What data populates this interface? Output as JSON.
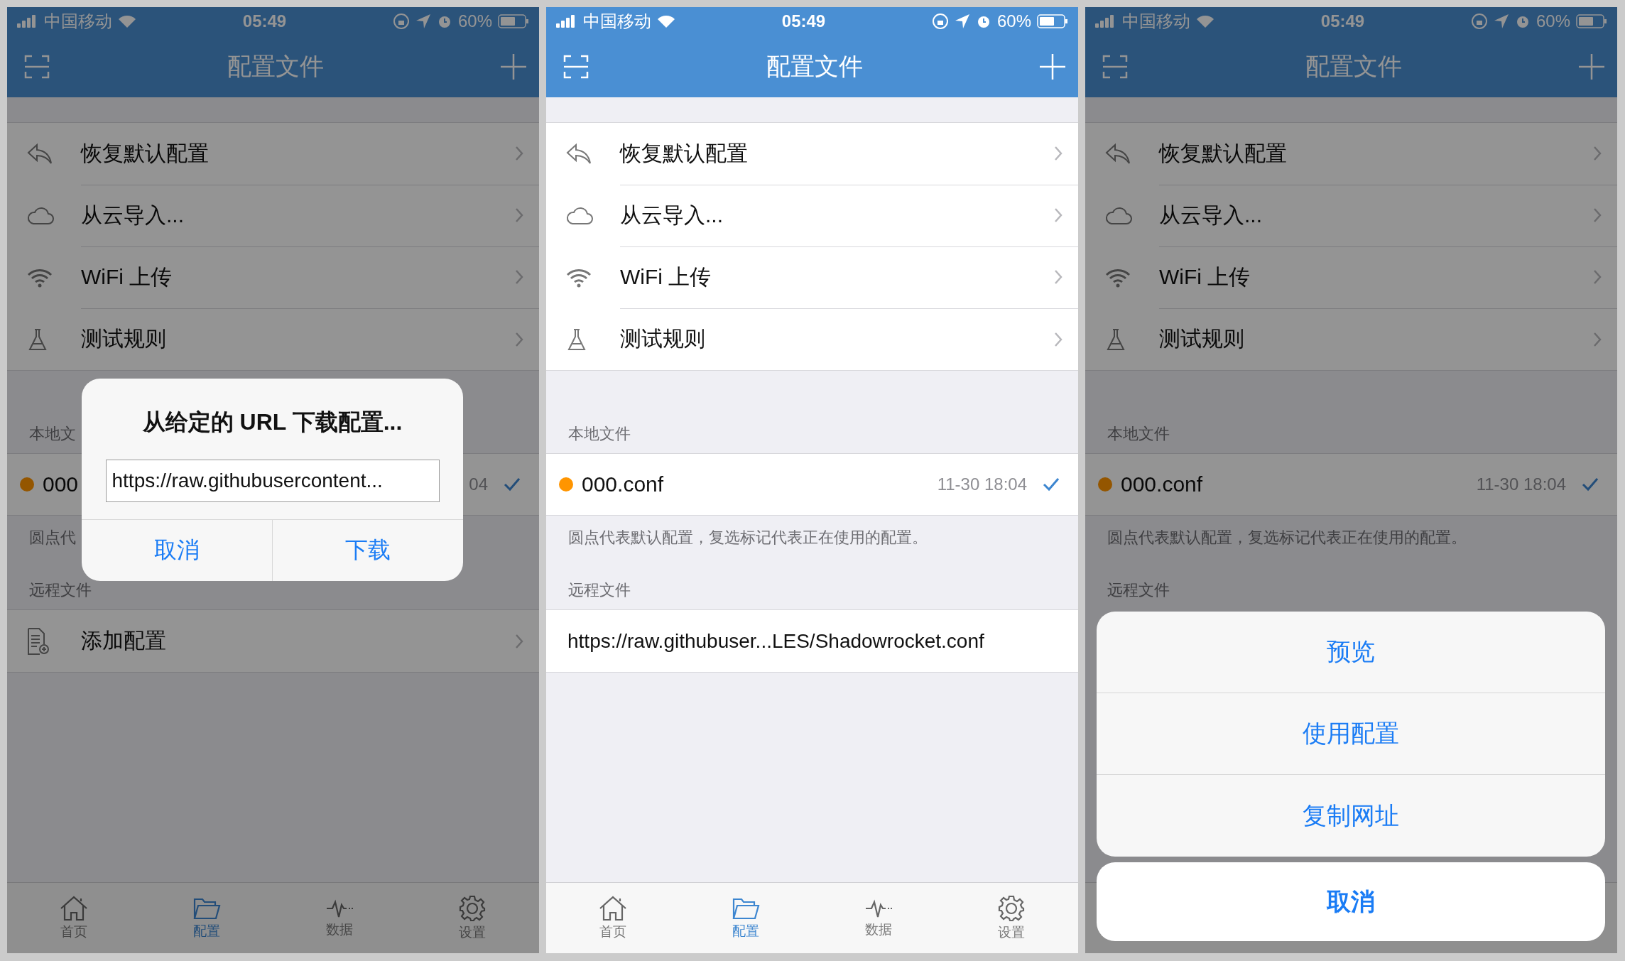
{
  "screens": [
    {
      "dimmed": true,
      "status_bar": {
        "carrier": "中国移动",
        "time": "05:49",
        "battery": "60%"
      },
      "nav": {
        "title": "配置文件"
      },
      "menu": [
        {
          "kind": "restore",
          "label": "恢复默认配置"
        },
        {
          "kind": "cloud",
          "label": "从云导入..."
        },
        {
          "kind": "wifi",
          "label": "WiFi 上传"
        },
        {
          "kind": "flask",
          "label": "测试规则"
        }
      ],
      "local_header": "本地文",
      "local_files": [
        {
          "name": "000",
          "date": "04",
          "default": true,
          "in_use": true
        }
      ],
      "footer": "圆点代",
      "remote_header": "远程文件",
      "remote_rows": [
        {
          "kind": "add",
          "label": "添加配置"
        }
      ],
      "tabs": [
        {
          "kind": "home",
          "label": "首页",
          "selected": false
        },
        {
          "kind": "folder",
          "label": "配置",
          "selected": true
        },
        {
          "kind": "pulse",
          "label": "数据",
          "selected": false
        },
        {
          "kind": "gear",
          "label": "设置",
          "selected": false
        }
      ],
      "alert": {
        "title": "从给定的 URL 下载配置...",
        "value": "https://raw.githubusercontent...",
        "buttons": [
          "取消",
          "下载"
        ]
      }
    },
    {
      "dimmed": false,
      "status_bar": {
        "carrier": "中国移动",
        "time": "05:49",
        "battery": "60%"
      },
      "nav": {
        "title": "配置文件"
      },
      "menu": [
        {
          "kind": "restore",
          "label": "恢复默认配置"
        },
        {
          "kind": "cloud",
          "label": "从云导入..."
        },
        {
          "kind": "wifi",
          "label": "WiFi 上传"
        },
        {
          "kind": "flask",
          "label": "测试规则"
        }
      ],
      "local_header": "本地文件",
      "local_files": [
        {
          "name": "000.conf",
          "date": "11-30 18:04",
          "default": true,
          "in_use": true
        }
      ],
      "footer": "圆点代表默认配置，复选标记代表正在使用的配置。",
      "remote_header": "远程文件",
      "remote_rows": [
        {
          "kind": "url",
          "label": "https://raw.githubuser...LES/Shadowrocket.conf"
        }
      ],
      "tabs": [
        {
          "kind": "home",
          "label": "首页",
          "selected": false
        },
        {
          "kind": "folder",
          "label": "配置",
          "selected": true
        },
        {
          "kind": "pulse",
          "label": "数据",
          "selected": false
        },
        {
          "kind": "gear",
          "label": "设置",
          "selected": false
        }
      ]
    },
    {
      "dimmed": true,
      "status_bar": {
        "carrier": "中国移动",
        "time": "05:49",
        "battery": "60%"
      },
      "nav": {
        "title": "配置文件"
      },
      "menu": [
        {
          "kind": "restore",
          "label": "恢复默认配置"
        },
        {
          "kind": "cloud",
          "label": "从云导入..."
        },
        {
          "kind": "wifi",
          "label": "WiFi 上传"
        },
        {
          "kind": "flask",
          "label": "测试规则"
        }
      ],
      "local_header": "本地文件",
      "local_files": [
        {
          "name": "000.conf",
          "date": "11-30 18:04",
          "default": true,
          "in_use": true
        }
      ],
      "footer": "圆点代表默认配置，复选标记代表正在使用的配置。",
      "remote_header": "远程文件",
      "action_sheet": {
        "actions": [
          "预览",
          "使用配置",
          "复制网址"
        ],
        "cancel": "取消"
      }
    }
  ]
}
